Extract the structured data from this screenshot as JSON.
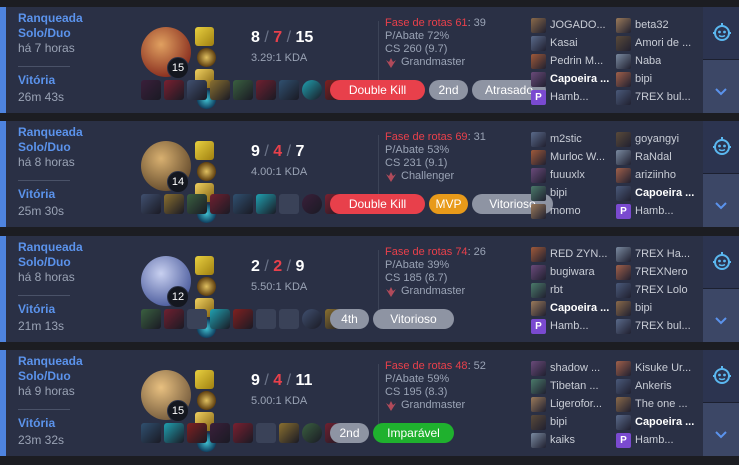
{
  "colors": {
    "accent": "#4e84e0",
    "death": "#e8404b",
    "card_bg": "#2a3045"
  },
  "icons": {
    "settings": "ai-robot-icon",
    "expand": "chevron-down-icon"
  },
  "matches": [
    {
      "queue": "Ranqueada Solo/Duo",
      "queue_l1": "Ranqueada",
      "queue_l2": "Solo/Duo",
      "ago": "há 7 horas",
      "result": "Vitória",
      "duration": "26m 43s",
      "level": "15",
      "kills": "8",
      "deaths": "7",
      "assists": "15",
      "kda_ratio": "3.29:1 KDA",
      "lane_label": "Fase de rotas 61",
      "lane_count": ": 39",
      "pabate": "P/Abate 72%",
      "cs": "CS 260 (9.7)",
      "tier": "Grandmaster",
      "badges": [
        "Double Kill",
        "2nd",
        "Atrasado"
      ],
      "team1": [
        "JOGADO...",
        "Kasai",
        "Pedrin M...",
        "Capoeira ...",
        "Hamb..."
      ],
      "team2": [
        "beta32",
        "Amori de ...",
        "Naba",
        "bipi",
        "7REX bul..."
      ]
    },
    {
      "queue_l1": "Ranqueada",
      "queue_l2": "Solo/Duo",
      "ago": "há 8 horas",
      "result": "Vitória",
      "duration": "25m 30s",
      "level": "14",
      "kills": "9",
      "deaths": "4",
      "assists": "7",
      "kda_ratio": "4.00:1 KDA",
      "lane_label": "Fase de rotas 69",
      "lane_count": ": 31",
      "pabate": "P/Abate 53%",
      "cs": "CS 231 (9.1)",
      "tier": "Challenger",
      "badges": [
        "Double Kill",
        "MVP",
        "Vitorioso"
      ],
      "team1": [
        "m2stic",
        "Murloc W...",
        "fuuuxlx",
        "bipi",
        "momo"
      ],
      "team2": [
        "goyangyi",
        "RaNdal",
        "ariziinho",
        "Capoeira ...",
        "Hamb..."
      ]
    },
    {
      "queue_l1": "Ranqueada",
      "queue_l2": "Solo/Duo",
      "ago": "há 8 horas",
      "result": "Vitória",
      "duration": "21m 13s",
      "level": "12",
      "kills": "2",
      "deaths": "2",
      "assists": "9",
      "kda_ratio": "5.50:1 KDA",
      "lane_label": "Fase de rotas 74",
      "lane_count": ": 26",
      "pabate": "P/Abate 39%",
      "cs": "CS 185 (8.7)",
      "tier": "Grandmaster",
      "badges": [
        "4th",
        "Vitorioso"
      ],
      "team1": [
        "RED ZYN...",
        "bugiwara",
        "rbt",
        "Capoeira ...",
        "Hamb..."
      ],
      "team2": [
        "7REX Ha...",
        "7REXNero",
        "7REX Lolo",
        "bipi",
        "7REX bul..."
      ]
    },
    {
      "queue_l1": "Ranqueada",
      "queue_l2": "Solo/Duo",
      "ago": "há 9 horas",
      "result": "Vitória",
      "duration": "23m 32s",
      "level": "15",
      "kills": "9",
      "deaths": "4",
      "assists": "11",
      "kda_ratio": "5.00:1 KDA",
      "lane_label": "Fase de rotas 48",
      "lane_count": ": 52",
      "pabate": "P/Abate 59%",
      "cs": "CS 195 (8.3)",
      "tier": "Grandmaster",
      "badges": [
        "2nd",
        "Imparável"
      ],
      "team1": [
        "shadow ...",
        "Tibetan ...",
        "Ligerofor...",
        "bipi",
        "kaiks"
      ],
      "team2": [
        "Kisuke Ur...",
        "Ankeris",
        "The one ...",
        "Capoeira ...",
        "Hamb..."
      ]
    }
  ]
}
